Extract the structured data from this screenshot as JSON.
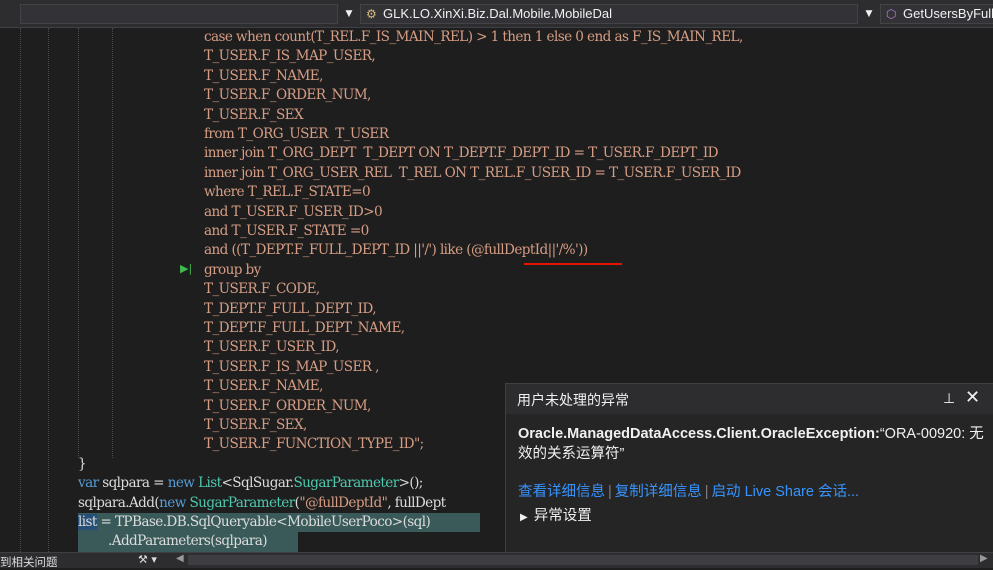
{
  "navbar": {
    "class_combo": "GLK.LO.XinXi.Biz.Dal.Mobile.MobileDal",
    "member_combo": "GetUsersByFullD"
  },
  "code": {
    "sql_lines": [
      "case when count(T_REL.F_IS_MAIN_REL) > 1 then 1 else 0 end as F_IS_MAIN_REL,",
      "T_USER.F_IS_MAP_USER,",
      "T_USER.F_NAME,",
      "T_USER.F_ORDER_NUM,",
      "T_USER.F_SEX",
      "from T_ORG_USER  T_USER",
      "inner join T_ORG_DEPT  T_DEPT ON T_DEPT.F_DEPT_ID = T_USER.F_DEPT_ID",
      "inner join T_ORG_USER_REL  T_REL ON T_REL.F_USER_ID = T_USER.F_USER_ID",
      "where T_REL.F_STATE=0",
      "and T_USER.F_USER_ID>0",
      "and T_USER.F_STATE =0",
      "and ((T_DEPT.F_FULL_DEPT_ID ||'/') like (@fullDeptId||'/%'))",
      "group by",
      "T_USER.F_CODE,",
      "T_DEPT.F_FULL_DEPT_ID,",
      "T_DEPT.F_FULL_DEPT_NAME,",
      "T_USER.F_USER_ID,",
      "T_USER.F_IS_MAP_USER ,",
      "T_USER.F_NAME,",
      "T_USER.F_ORDER_NUM,",
      "T_USER.F_SEX,",
      "T_USER.F_FUNCTION_TYPE_ID\";"
    ],
    "brace": "}",
    "line_var": {
      "kw": "var",
      "rest1": " sqlpara = ",
      "kw2": "new",
      "rest2": " ",
      "type1": "List",
      "rest3": "<SqlSugar.",
      "type2": "SugarParameter",
      "rest4": ">();"
    },
    "line_add": {
      "rest1": "sqlpara.Add(",
      "kw": "new",
      "rest2": " ",
      "type": "SugarParameter",
      "rest3": "(",
      "str": "\"@fullDeptId\"",
      "rest4": ", fullDept"
    },
    "line_list": {
      "sel": "list",
      "rest1": " = TPBase.DB.SqlQueryable<MobileUserPoco>(sql)"
    },
    "line_params": ".AddParameters(sqlpara)"
  },
  "exception": {
    "title": "用户未处理的异常",
    "type": "Oracle.ManagedDataAccess.Client.OracleException:",
    "message": "“ORA-00920: 无效的关系运算符”",
    "links": [
      "查看详细信息",
      "复制详细信息",
      "启动 Live Share 会话..."
    ],
    "settings": "异常设置",
    "pin_icon": "pin-icon",
    "close_icon": "close-icon"
  },
  "statusbar": {
    "issues": "到相关问题"
  }
}
